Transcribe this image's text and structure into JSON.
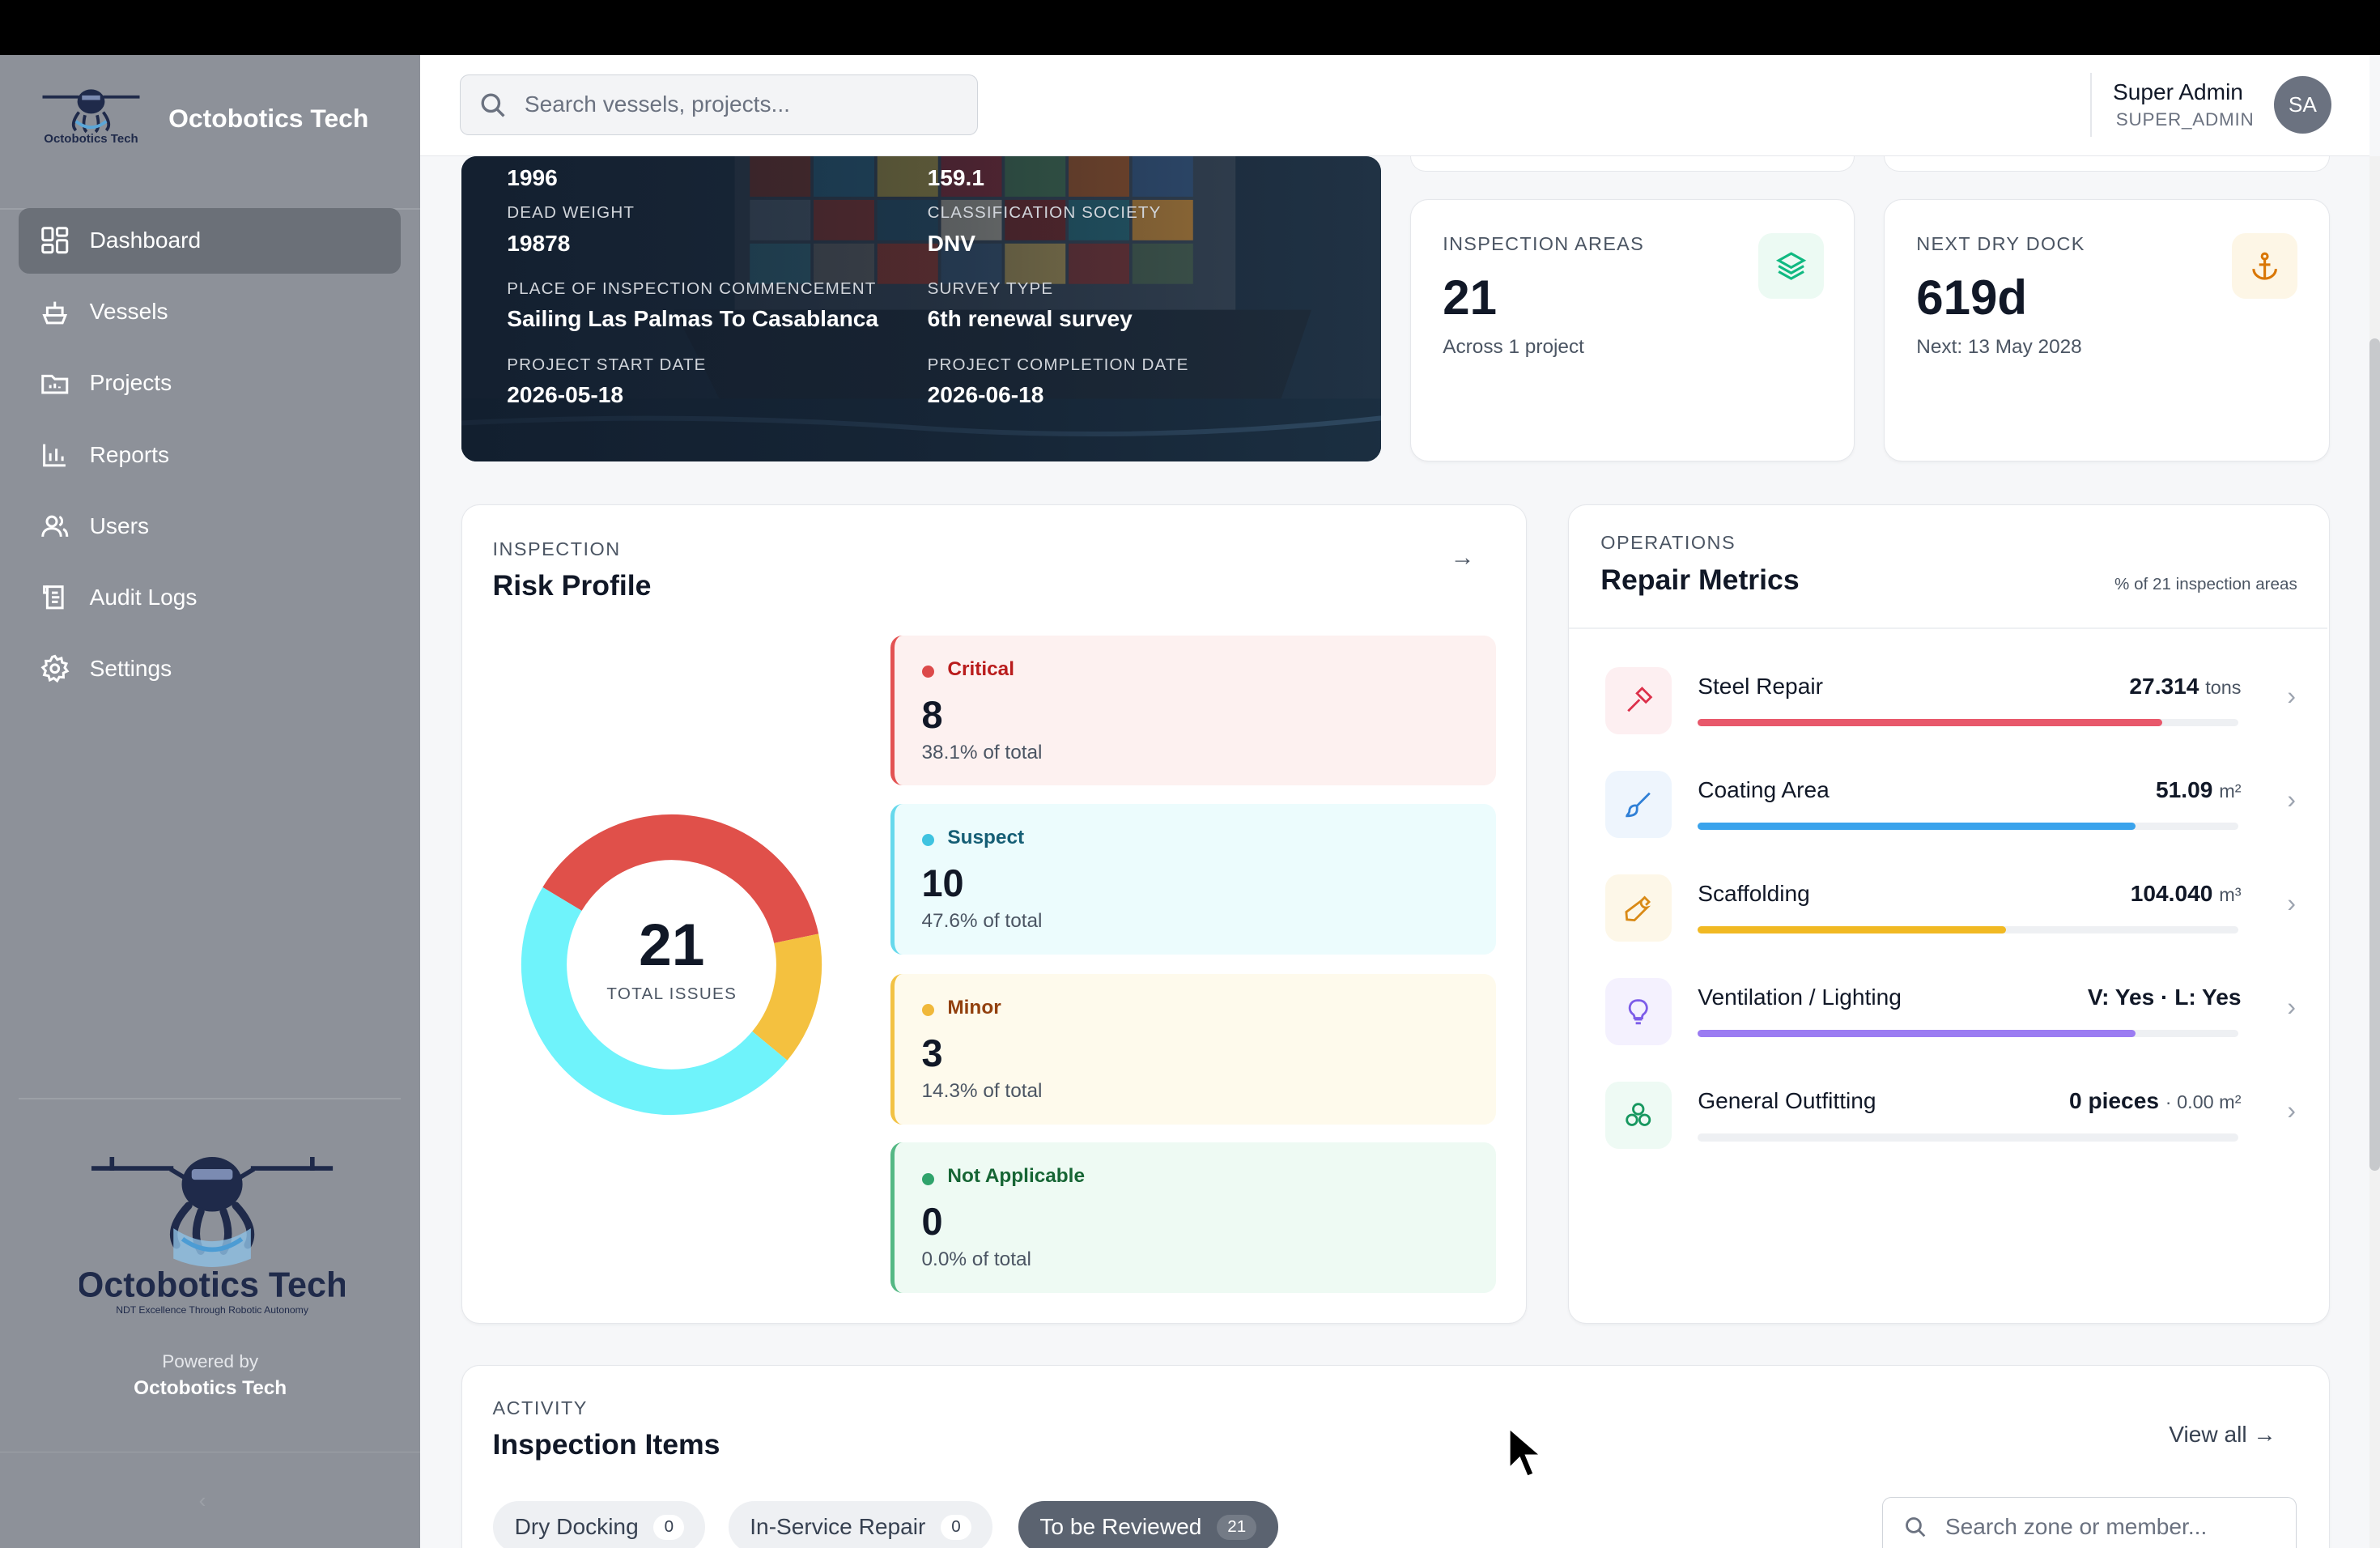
{
  "app": {
    "name": "Octobotics Tech"
  },
  "sidebar": {
    "brand": "Octobotics Tech",
    "items": [
      {
        "label": "Dashboard",
        "icon": "dashboard-icon",
        "active": true
      },
      {
        "label": "Vessels",
        "icon": "ship-icon"
      },
      {
        "label": "Projects",
        "icon": "folder-icon"
      },
      {
        "label": "Reports",
        "icon": "bar-chart-icon"
      },
      {
        "label": "Users",
        "icon": "users-icon"
      },
      {
        "label": "Audit Logs",
        "icon": "scroll-icon"
      },
      {
        "label": "Settings",
        "icon": "gear-icon"
      }
    ],
    "footer_logo_text": "Octobotics Tech",
    "footer_logo_tagline": "NDT Excellence Through Robotic Autonomy",
    "powered_by_label": "Powered by",
    "powered_by_name": "Octobotics Tech",
    "collapse_icon": "chevron-left-icon"
  },
  "header": {
    "search_placeholder": "Search vessels, projects...",
    "user_name": "Super Admin",
    "user_role": "SUPER_ADMIN",
    "user_initials": "SA"
  },
  "vessel": {
    "fields": [
      {
        "label": "",
        "value": "1996"
      },
      {
        "label": "",
        "value": "159.1"
      },
      {
        "label": "DEAD WEIGHT",
        "value": "19878"
      },
      {
        "label": "CLASSIFICATION SOCIETY",
        "value": "DNV"
      },
      {
        "label": "PLACE OF INSPECTION COMMENCEMENT",
        "value": "Sailing Las Palmas To Casablanca"
      },
      {
        "label": "SURVEY TYPE",
        "value": "6th renewal survey"
      },
      {
        "label": "PROJECT START DATE",
        "value": "2026-05-18"
      },
      {
        "label": "PROJECT COMPLETION DATE",
        "value": "2026-06-18"
      }
    ]
  },
  "kpis": [
    {
      "label": "INSPECTION AREAS",
      "value": "21",
      "sub": "Across 1 project",
      "icon": "layers-icon",
      "color": "#10b981"
    },
    {
      "label": "NEXT DRY DOCK",
      "value": "619d",
      "sub": "Next: 13 May 2028",
      "icon": "anchor-icon",
      "color": "#d97706"
    }
  ],
  "risk": {
    "kicker": "INSPECTION",
    "title": "Risk Profile",
    "total": "21",
    "total_label": "TOTAL ISSUES",
    "items": [
      {
        "name": "Critical",
        "count": 8,
        "pct": "38.1% of total",
        "color": "#dc4a4a",
        "text_color": "#b91c1c",
        "bg": "#fdf1f0",
        "border": "#e35353"
      },
      {
        "name": "Suspect",
        "count": 10,
        "pct": "47.6% of total",
        "color": "#3fc3e0",
        "text_color": "#155e75",
        "bg": "#ecfcfd",
        "border": "#67d9ec"
      },
      {
        "name": "Minor",
        "count": 3,
        "pct": "14.3% of total",
        "color": "#f0b83a",
        "text_color": "#92400e",
        "bg": "#fefaec",
        "border": "#f2c244"
      },
      {
        "name": "Not Applicable",
        "count": 0,
        "pct": "0.0% of total",
        "color": "#2fa36b",
        "text_color": "#166534",
        "bg": "#eefaf3",
        "border": "#54b884"
      }
    ],
    "donut_colors": {
      "critical": "#e0504a",
      "suspect": "#6ff3fb",
      "minor": "#f4c13f"
    }
  },
  "repair": {
    "kicker": "OPERATIONS",
    "title": "Repair Metrics",
    "note": "% of 21 inspection areas",
    "rows": [
      {
        "name": "Steel Repair",
        "value": "27.314",
        "unit": "tons",
        "level": 0.86,
        "color": "#e8586b",
        "icon": "hammer-icon",
        "icon_bg": "#fdeff1",
        "icon_color": "#dc2f4a"
      },
      {
        "name": "Coating Area",
        "value": "51.09",
        "unit": "m²",
        "level": 0.81,
        "color": "#3aa3ec",
        "icon": "brush-icon",
        "icon_bg": "#eef5fd",
        "icon_color": "#2f7fd6"
      },
      {
        "name": "Scaffolding",
        "value": "104.040",
        "unit": "m³",
        "level": 0.57,
        "color": "#f1b923",
        "icon": "wrench-icon",
        "icon_bg": "#fdf7e8",
        "icon_color": "#d98a16"
      },
      {
        "name": "Ventilation / Lighting",
        "value": "V: Yes · L: Yes",
        "unit": "",
        "level": 0.81,
        "color": "#9b7cf2",
        "icon": "lightbulb-icon",
        "icon_bg": "#f4f1fe",
        "icon_color": "#7c5ce8"
      },
      {
        "name": "General Outfitting",
        "value": "0 pieces",
        "unit": "· 0.00 m²",
        "level": 0,
        "color": "#10b981",
        "icon": "boxes-icon",
        "icon_bg": "#eefaf4",
        "icon_color": "#17975f"
      }
    ]
  },
  "activity": {
    "kicker": "ACTIVITY",
    "title": "Inspection Items",
    "view_all": "View all →",
    "tabs": [
      {
        "label": "Dry Docking",
        "count": "0"
      },
      {
        "label": "In-Service Repair",
        "count": "0"
      },
      {
        "label": "To be Reviewed",
        "count": "21",
        "active": true
      }
    ],
    "search_placeholder": "Search zone or member..."
  }
}
